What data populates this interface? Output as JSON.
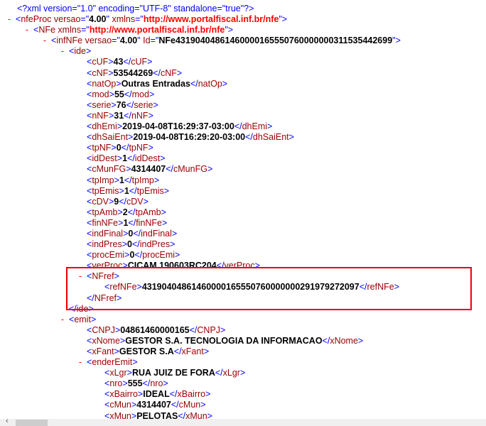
{
  "declaration": "<?xml version=\"1.0\" encoding=\"UTF-8\" standalone=\"true\"?>",
  "collapse_symbol": "-",
  "lines": [
    {
      "level": 0,
      "kind": "open",
      "collapsible": true,
      "name": "nfeProc",
      "attrs": [
        {
          "name": "versao",
          "value": "4.00"
        },
        {
          "name": "xmlns",
          "value": "http://www.portalfiscal.inf.br/nfe",
          "link": true
        }
      ]
    },
    {
      "level": 1,
      "kind": "open",
      "collapsible": true,
      "name": "NFe",
      "attrs": [
        {
          "name": "xmlns",
          "value": "http://www.portalfiscal.inf.br/nfe",
          "link": true
        }
      ]
    },
    {
      "level": 2,
      "kind": "open",
      "collapsible": true,
      "name": "infNFe",
      "attrs": [
        {
          "name": "versao",
          "value": "4.00"
        },
        {
          "name": "Id",
          "value": "NFe43190404861460000165550760000000311535442699"
        }
      ]
    },
    {
      "level": 3,
      "kind": "open",
      "collapsible": true,
      "name": "ide",
      "attrs": []
    },
    {
      "level": 4,
      "kind": "leaf",
      "name": "cUF",
      "text": "43"
    },
    {
      "level": 4,
      "kind": "leaf",
      "name": "cNF",
      "text": "53544269"
    },
    {
      "level": 4,
      "kind": "leaf",
      "name": "natOp",
      "text": "Outras Entradas"
    },
    {
      "level": 4,
      "kind": "leaf",
      "name": "mod",
      "text": "55"
    },
    {
      "level": 4,
      "kind": "leaf",
      "name": "serie",
      "text": "76"
    },
    {
      "level": 4,
      "kind": "leaf",
      "name": "nNF",
      "text": "31"
    },
    {
      "level": 4,
      "kind": "leaf",
      "name": "dhEmi",
      "text": "2019-04-08T16:29:37-03:00"
    },
    {
      "level": 4,
      "kind": "leaf",
      "name": "dhSaiEnt",
      "text": "2019-04-08T16:29:20-03:00"
    },
    {
      "level": 4,
      "kind": "leaf",
      "name": "tpNF",
      "text": "0"
    },
    {
      "level": 4,
      "kind": "leaf",
      "name": "idDest",
      "text": "1"
    },
    {
      "level": 4,
      "kind": "leaf",
      "name": "cMunFG",
      "text": "4314407"
    },
    {
      "level": 4,
      "kind": "leaf",
      "name": "tpImp",
      "text": "1"
    },
    {
      "level": 4,
      "kind": "leaf",
      "name": "tpEmis",
      "text": "1"
    },
    {
      "level": 4,
      "kind": "leaf",
      "name": "cDV",
      "text": "9"
    },
    {
      "level": 4,
      "kind": "leaf",
      "name": "tpAmb",
      "text": "2"
    },
    {
      "level": 4,
      "kind": "leaf",
      "name": "finNFe",
      "text": "1"
    },
    {
      "level": 4,
      "kind": "leaf",
      "name": "indFinal",
      "text": "0"
    },
    {
      "level": 4,
      "kind": "leaf",
      "name": "indPres",
      "text": "0"
    },
    {
      "level": 4,
      "kind": "leaf",
      "name": "procEmi",
      "text": "0"
    },
    {
      "level": 4,
      "kind": "leaf",
      "name": "verProc",
      "text": "CICAM 190603RC204"
    },
    {
      "level": 4,
      "kind": "open",
      "collapsible": true,
      "name": "NFref",
      "attrs": []
    },
    {
      "level": 5,
      "kind": "leaf",
      "name": "refNFe",
      "text": "43190404861460000165550760000000291979272097"
    },
    {
      "level": 4,
      "kind": "close",
      "name": "NFref"
    },
    {
      "level": 3,
      "kind": "close",
      "name": "ide"
    },
    {
      "level": 3,
      "kind": "open",
      "collapsible": true,
      "name": "emit",
      "attrs": []
    },
    {
      "level": 4,
      "kind": "leaf",
      "name": "CNPJ",
      "text": "04861460000165"
    },
    {
      "level": 4,
      "kind": "leaf",
      "name": "xNome",
      "text": "GESTOR S.A. TECNOLOGIA DA INFORMACAO"
    },
    {
      "level": 4,
      "kind": "leaf",
      "name": "xFant",
      "text": "GESTOR S.A"
    },
    {
      "level": 4,
      "kind": "open",
      "collapsible": true,
      "name": "enderEmit",
      "attrs": []
    },
    {
      "level": 5,
      "kind": "leaf",
      "name": "xLgr",
      "text": "RUA JUIZ DE FORA"
    },
    {
      "level": 5,
      "kind": "leaf",
      "name": "nro",
      "text": "555"
    },
    {
      "level": 5,
      "kind": "leaf",
      "name": "xBairro",
      "text": "IDEAL"
    },
    {
      "level": 5,
      "kind": "leaf",
      "name": "cMun",
      "text": "4314407"
    },
    {
      "level": 5,
      "kind": "leaf",
      "name": "xMun",
      "text": "PELOTAS"
    }
  ],
  "scrollbar": {
    "left_arrow": "‹"
  },
  "colors": {
    "bracket": "#0000ff",
    "tag": "#990000",
    "link": "#ff0000",
    "highlight": "#ee0000"
  }
}
